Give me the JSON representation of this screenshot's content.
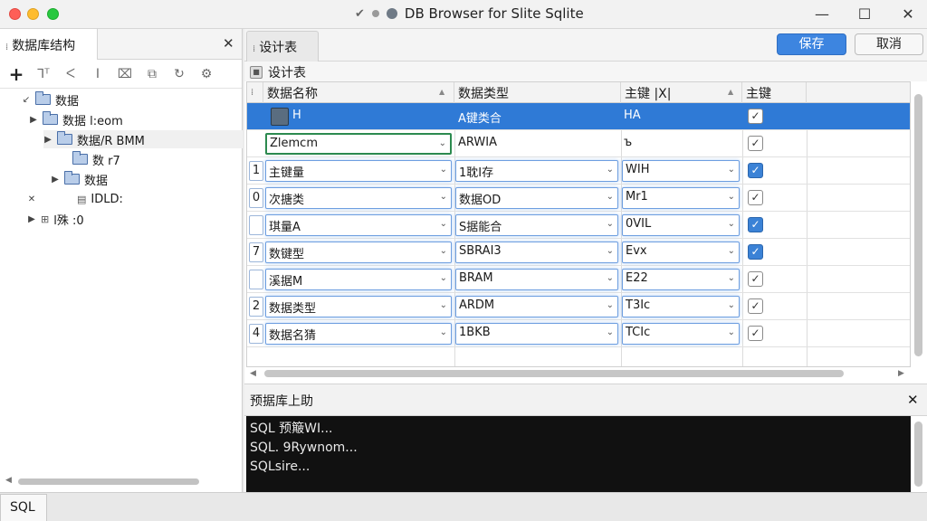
{
  "window": {
    "title": "DB Browser for Slite Sqlite",
    "min": "—",
    "max": "☐",
    "close": "✕"
  },
  "left_panel": {
    "tab_label": "数据库结构",
    "close": "✕",
    "toolbar": [
      "+",
      "⅂ᵀ",
      "ᐸ",
      "I",
      "⌧",
      "⧉",
      "↻",
      "⚙"
    ],
    "tree": [
      {
        "label": "数据",
        "depth": 0,
        "arrow": "↙",
        "icon": "folder"
      },
      {
        "label": "数据 l:eom",
        "depth": 1,
        "arrow": "▶",
        "icon": "folder"
      },
      {
        "label": "数据/R BMM",
        "depth": 2,
        "arrow": "▶",
        "icon": "folder",
        "selected": true
      },
      {
        "label": "数 r7",
        "depth": 3,
        "arrow": "",
        "icon": "folder"
      },
      {
        "label": "数据",
        "depth": 2,
        "arrow": "▶",
        "icon": "folder"
      },
      {
        "label": "IDLD:",
        "depth": 1,
        "arrow": "✕",
        "icon": "doc"
      },
      {
        "label": "l殊 :0",
        "depth": 0,
        "arrow": "▶",
        "icon": "table"
      }
    ]
  },
  "sql_tab": "SQL",
  "right_panel": {
    "tab_label": "设计表",
    "save_label": "保存",
    "cancel_label": "取消",
    "sub_title": "设计表",
    "columns": [
      "数据名称",
      "数据类型",
      "主键 |X|",
      "主键"
    ],
    "rows": [
      {
        "num": "",
        "name": "H",
        "type": "A键类合",
        "key": "HA",
        "checked": false,
        "selected": true
      },
      {
        "num": "",
        "name": "Zlemcm",
        "type": "ARWIA",
        "key": "ъ",
        "checked": false
      },
      {
        "num": "1",
        "name": "主键量",
        "type": "1耽I存",
        "key": "WIH",
        "checked": true
      },
      {
        "num": "0",
        "name": "次搪类",
        "type": "数据OD",
        "key": "Mr1",
        "checked": false
      },
      {
        "num": "",
        "name": "琪量A",
        "type": "S据能合",
        "key": "0VIL",
        "checked": true
      },
      {
        "num": "7",
        "name": "数键型",
        "type": "SBRAI3",
        "key": "Evx",
        "checked": true
      },
      {
        "num": "",
        "name": "溪据M",
        "type": "BRAM",
        "key": "E22",
        "checked": false
      },
      {
        "num": "2",
        "name": "数据类型",
        "type": "ARDM",
        "key": "T3Ic",
        "checked": false
      },
      {
        "num": "4",
        "name": "数据名猜",
        "type": "1BKB",
        "key": "TCIc",
        "checked": false
      }
    ]
  },
  "log_panel": {
    "title": "预据库上助",
    "close": "✕",
    "lines": [
      "SQL 预簸WI...",
      "SQL. 9Rywnom...",
      "SQLsire..."
    ]
  },
  "colors": {
    "accent": "#3d85e0",
    "selection": "#2f7ad6"
  }
}
